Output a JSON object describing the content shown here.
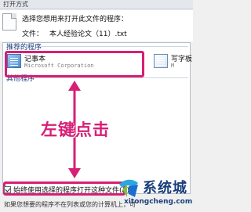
{
  "window": {
    "title": "打开方式"
  },
  "header": {
    "prompt": "选择您想用来打开此文件的程序：",
    "file_label": "文件：",
    "file_name": "本人经验论文（11）.txt"
  },
  "groups": {
    "recommended": "推荐的程序",
    "other": "其他程序"
  },
  "programs": [
    {
      "name": "记事本",
      "company": "Microsoft Corporation"
    },
    {
      "name": "写字板",
      "company": "M"
    }
  ],
  "annotation": "左键点击",
  "checkbox": {
    "label": "始终使用选择的程序打开这种文件(A)",
    "checked": true
  },
  "footer": "如果您想要的程序不在列表或您的计算机上，可",
  "watermark": {
    "brand": "系统城",
    "url": "xitongcheng.com"
  },
  "colors": {
    "accent": "#d61f76",
    "brand": "#1b3f7a"
  }
}
